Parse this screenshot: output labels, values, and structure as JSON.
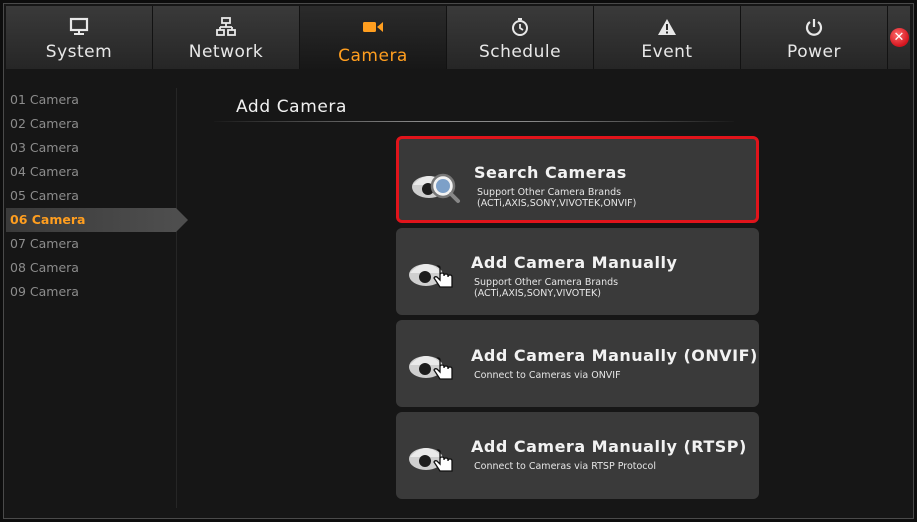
{
  "tabs": [
    {
      "label": "System",
      "icon": "monitor-icon"
    },
    {
      "label": "Network",
      "icon": "network-icon"
    },
    {
      "label": "Camera",
      "icon": "camera-icon",
      "active": true
    },
    {
      "label": "Schedule",
      "icon": "clock-icon"
    },
    {
      "label": "Event",
      "icon": "warning-icon"
    },
    {
      "label": "Power",
      "icon": "power-icon"
    }
  ],
  "close_icon": "close-icon",
  "sidebar": {
    "items": [
      {
        "label": "01 Camera"
      },
      {
        "label": "02 Camera"
      },
      {
        "label": "03 Camera"
      },
      {
        "label": "04 Camera"
      },
      {
        "label": "05 Camera"
      },
      {
        "label": "06 Camera",
        "active": true
      },
      {
        "label": "07 Camera"
      },
      {
        "label": "08 Camera"
      },
      {
        "label": "09 Camera"
      }
    ]
  },
  "main": {
    "title": "Add Camera",
    "options": [
      {
        "title": "Search Cameras",
        "subtitle": [
          "Support Other Camera Brands",
          "(ACTi,AXIS,SONY,VIVOTEK,ONVIF)"
        ],
        "icon": "camera-search-icon",
        "selected": true
      },
      {
        "title": "Add Camera Manually",
        "subtitle": [
          "Support Other Camera Brands",
          "(ACTi,AXIS,SONY,VIVOTEK)"
        ],
        "icon": "camera-hand-icon"
      },
      {
        "title": "Add Camera Manually (ONVIF)",
        "subtitle": [
          "Connect to Cameras via ONVIF"
        ],
        "icon": "camera-hand-icon"
      },
      {
        "title": "Add Camera Manually (RTSP)",
        "subtitle": [
          "Connect to Cameras via RTSP Protocol"
        ],
        "icon": "camera-hand-icon"
      }
    ]
  },
  "colors": {
    "accent": "#ff9e1f",
    "selection_border": "#e0141b",
    "card_bg": "#3a3a3a"
  }
}
